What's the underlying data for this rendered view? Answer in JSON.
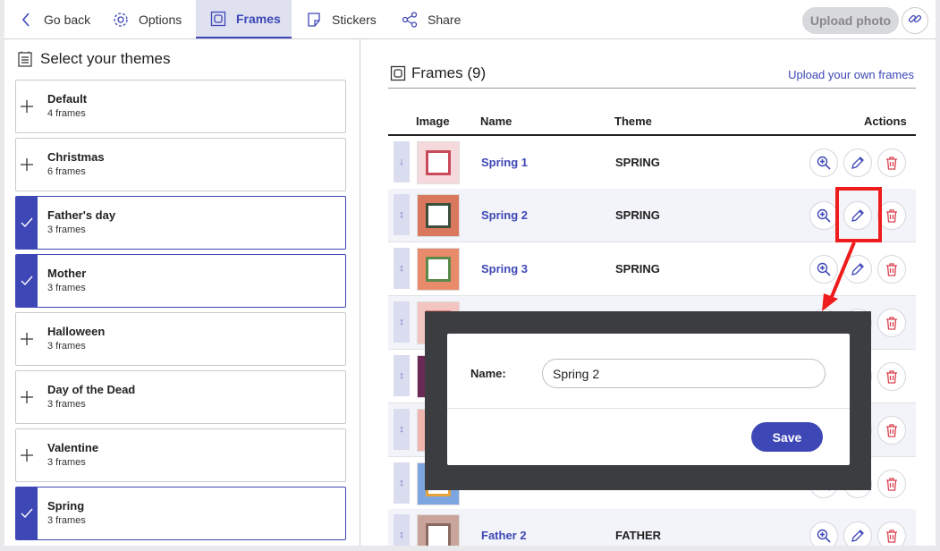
{
  "topbar": {
    "go_back": "Go back",
    "options": "Options",
    "frames": "Frames",
    "stickers": "Stickers",
    "share": "Share",
    "upload_photo": "Upload photo"
  },
  "left": {
    "title": "Select your themes",
    "themes": [
      {
        "name": "Default",
        "count": "4 frames",
        "selected": false
      },
      {
        "name": "Christmas",
        "count": "6 frames",
        "selected": false
      },
      {
        "name": "Father's day",
        "count": "3 frames",
        "selected": true
      },
      {
        "name": "Mother",
        "count": "3 frames",
        "selected": true
      },
      {
        "name": "Halloween",
        "count": "3 frames",
        "selected": false
      },
      {
        "name": "Day of the Dead",
        "count": "3 frames",
        "selected": false
      },
      {
        "name": "Valentine",
        "count": "3 frames",
        "selected": false
      },
      {
        "name": "Spring",
        "count": "3 frames",
        "selected": true
      }
    ]
  },
  "right": {
    "title": "Frames (9)",
    "upload_own": "Upload your own frames",
    "columns": {
      "image": "Image",
      "name": "Name",
      "theme": "Theme",
      "actions": "Actions"
    },
    "rows": [
      {
        "name": "Spring 1",
        "theme": "SPRING",
        "drag": "↓",
        "thumb_outer": "#f6d9dc",
        "thumb_accent": "#c94a5a"
      },
      {
        "name": "Spring 2",
        "theme": "SPRING",
        "drag": "↕",
        "thumb_outer": "#d9785e",
        "thumb_accent": "#3d4f3a"
      },
      {
        "name": "Spring 3",
        "theme": "SPRING",
        "drag": "↕",
        "thumb_outer": "#e98a6b",
        "thumb_accent": "#5b8a4a"
      },
      {
        "name": "",
        "theme": "",
        "drag": "↕",
        "thumb_outer": "#f2c5c0",
        "thumb_accent": "#e07a6a"
      },
      {
        "name": "",
        "theme": "",
        "drag": "↕",
        "thumb_outer": "#6b2a55",
        "thumb_accent": "#c96b9a"
      },
      {
        "name": "",
        "theme": "",
        "drag": "↕",
        "thumb_outer": "#f0b5ae",
        "thumb_accent": "#e8685a"
      },
      {
        "name": "",
        "theme": "",
        "drag": "↕",
        "thumb_outer": "#7da6e0",
        "thumb_accent": "#e7a23a"
      },
      {
        "name": "Father 2",
        "theme": "FATHER",
        "drag": "↕",
        "thumb_outer": "#c9a49a",
        "thumb_accent": "#8a6a60"
      }
    ]
  },
  "dialog": {
    "label": "Name:",
    "value": "Spring 2",
    "save": "Save"
  },
  "colors": {
    "accent": "#3e47b6",
    "delete": "#d9414f",
    "annotation": "#ee1c1c"
  }
}
